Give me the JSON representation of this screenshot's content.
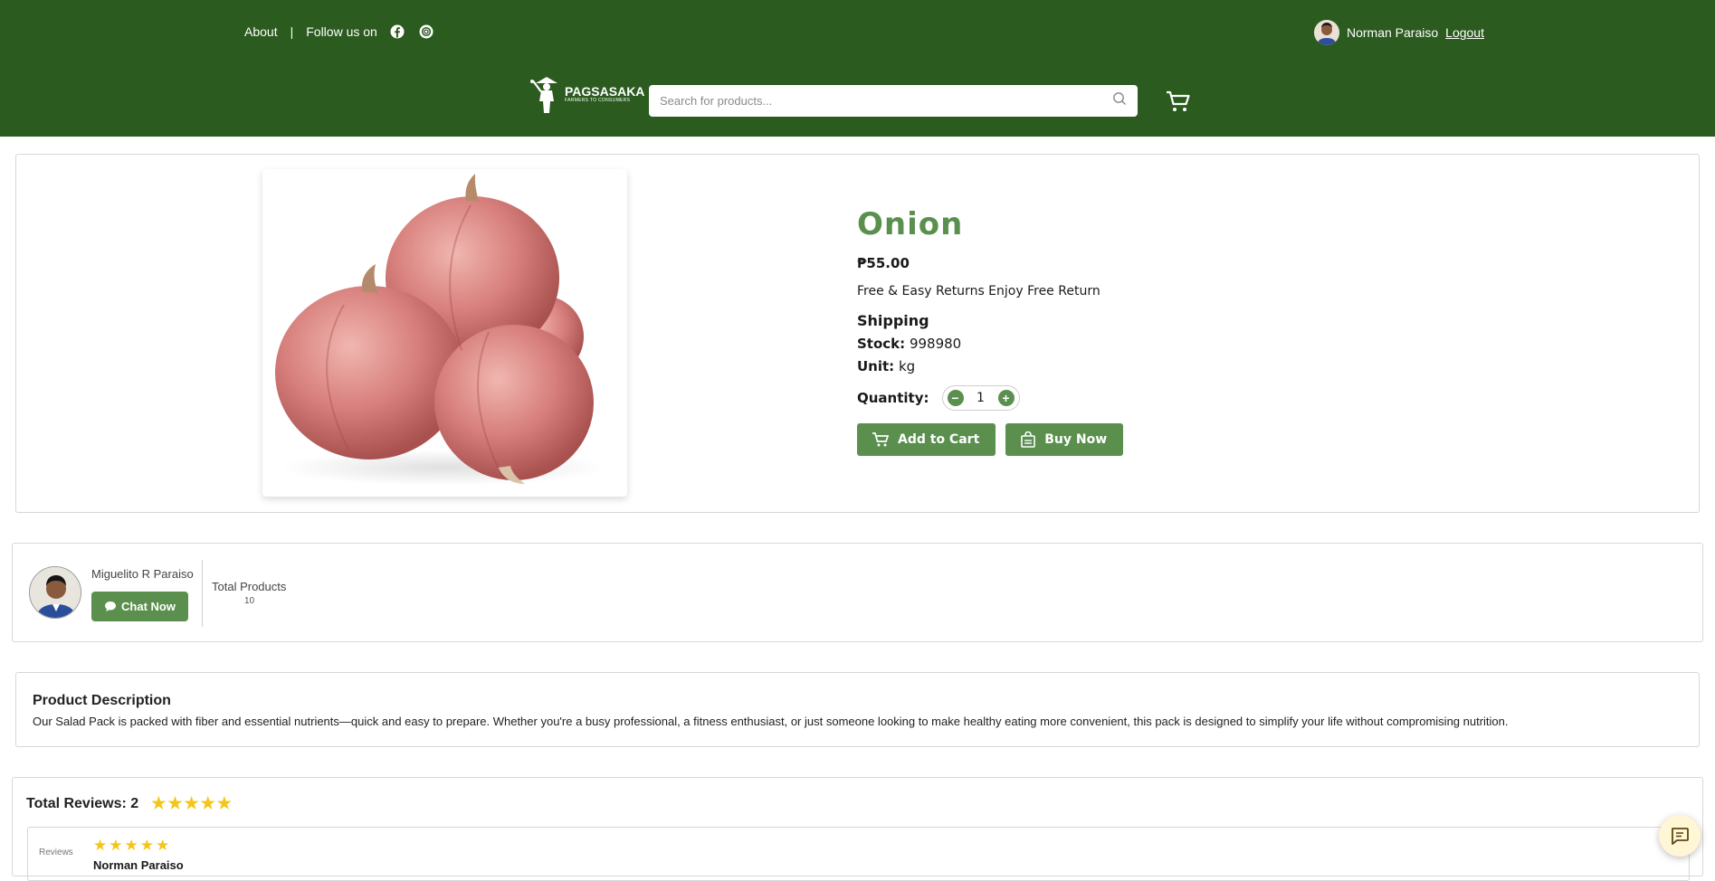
{
  "header": {
    "about_label": "About",
    "separator": "|",
    "follow_label": "Follow us on",
    "user_name": "Norman Paraiso",
    "logout_label": "Logout",
    "brand_name": "PAGSASAKA",
    "brand_tagline": "FARMERS TO CONSUMERS",
    "search_placeholder": "Search for products...",
    "social_icons": [
      "facebook-icon",
      "instagram-icon"
    ]
  },
  "product": {
    "name": "Onion",
    "price": "₱55.00",
    "returns": "Free & Easy Returns Enjoy Free Return",
    "shipping_label": "Shipping",
    "stock_label": "Stock:",
    "stock_value": "998980",
    "unit_label": "Unit:",
    "unit_value": "kg",
    "quantity_label": "Quantity:",
    "quantity_value": "1",
    "add_to_cart_label": "Add to Cart",
    "buy_now_label": "Buy Now"
  },
  "seller": {
    "name": "Miguelito R Paraiso",
    "chat_label": "Chat Now",
    "total_products_label": "Total Products",
    "total_products_value": "10"
  },
  "description": {
    "heading": "Product Description",
    "text": "Our Salad Pack is packed with fiber and essential nutrients—quick and easy to prepare. Whether you're a busy professional, a fitness enthusiast, or just someone looking to make healthy eating more convenient, this pack is designed to simplify your life without compromising nutrition."
  },
  "reviews": {
    "total_label": "Total Reviews: 2",
    "rating": 5,
    "stars": "★★★★★",
    "items": [
      {
        "image_alt": "Reviews",
        "stars": "★★★★★",
        "name": "Norman Paraiso"
      }
    ]
  },
  "colors": {
    "header_bg": "#2b5b1e",
    "accent": "#5a8f4e",
    "star": "#f5c518"
  }
}
